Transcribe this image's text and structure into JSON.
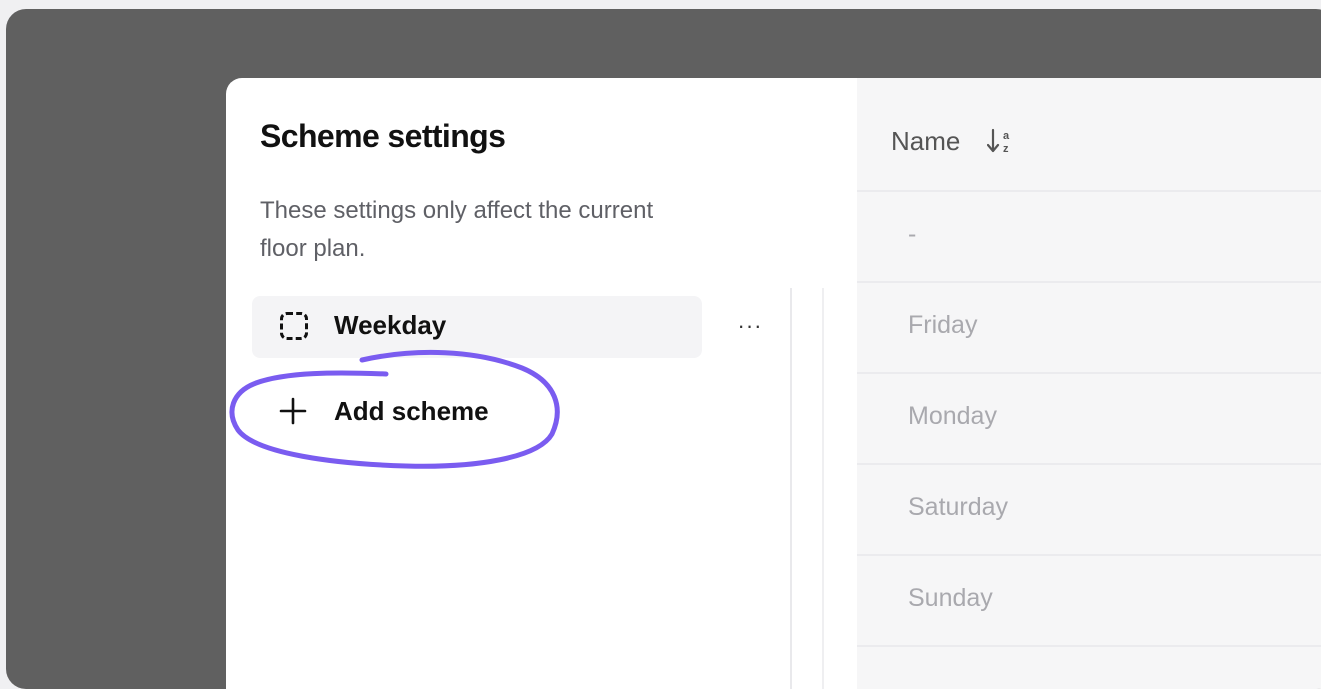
{
  "dialog": {
    "title": "Scheme settings",
    "description": "These settings only affect the current floor plan."
  },
  "schemes": {
    "items": [
      {
        "label": "Weekday",
        "icon": "dashed-square-icon"
      }
    ],
    "more_icon": "ellipsis-icon",
    "more_label": "···",
    "add_label": "Add scheme",
    "add_icon": "plus-icon"
  },
  "table": {
    "column_header": "Name",
    "sort_icon": "sort-a-z-icon",
    "rows": [
      "-",
      "Friday",
      "Monday",
      "Saturday",
      "Sunday"
    ]
  },
  "colors": {
    "annotation": "#7a5cf0",
    "backdrop": "#606060"
  }
}
